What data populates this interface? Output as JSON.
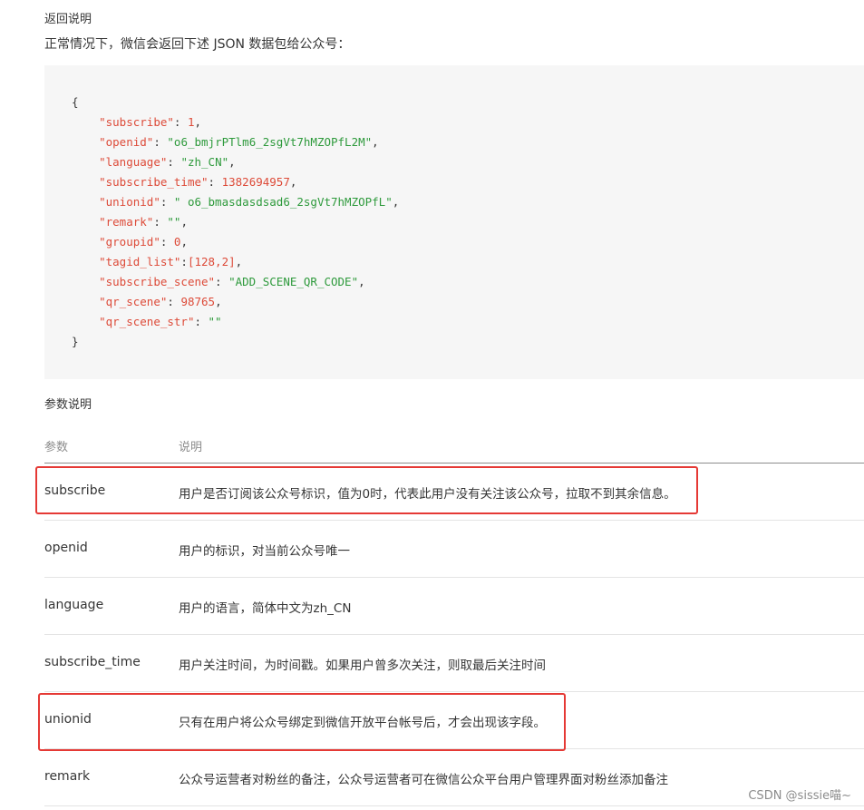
{
  "return_title": "返回说明",
  "intro": "正常情况下，微信会返回下述 JSON 数据包给公众号：",
  "code": [
    {
      "text": "{",
      "type": "brace"
    },
    {
      "key": "\"subscribe\"",
      "val": "1",
      "vtype": "n",
      "comma": ","
    },
    {
      "key": "\"openid\"",
      "val": "\"o6_bmjrPTlm6_2sgVt7hMZOPfL2M\"",
      "vtype": "s",
      "comma": ","
    },
    {
      "key": "\"language\"",
      "val": "\"zh_CN\"",
      "vtype": "s",
      "comma": ","
    },
    {
      "key": "\"subscribe_time\"",
      "val": "1382694957",
      "vtype": "n",
      "comma": ","
    },
    {
      "key": "\"unionid\"",
      "val": "\" o6_bmasdasdsad6_2sgVt7hMZOPfL\"",
      "vtype": "s",
      "comma": ","
    },
    {
      "key": "\"remark\"",
      "val": "\"\"",
      "vtype": "s",
      "comma": ","
    },
    {
      "key": "\"groupid\"",
      "val": "0",
      "vtype": "n",
      "comma": ","
    },
    {
      "key": "\"tagid_list\"",
      "val": "[128,2]",
      "vtype": "n",
      "comma": ",",
      "nospace": true
    },
    {
      "key": "\"subscribe_scene\"",
      "val": "\"ADD_SCENE_QR_CODE\"",
      "vtype": "s",
      "comma": ","
    },
    {
      "key": "\"qr_scene\"",
      "val": "98765",
      "vtype": "n",
      "comma": ","
    },
    {
      "key": "\"qr_scene_str\"",
      "val": "\"\"",
      "vtype": "s",
      "comma": ""
    },
    {
      "text": "}",
      "type": "brace"
    }
  ],
  "params_title": "参数说明",
  "table": {
    "headers": [
      "参数",
      "说明"
    ],
    "rows": [
      {
        "param": "subscribe",
        "desc": "用户是否订阅该公众号标识，值为0时，代表此用户没有关注该公众号，拉取不到其余信息。",
        "highlight": true
      },
      {
        "param": "openid",
        "desc": "用户的标识，对当前公众号唯一",
        "highlight": false
      },
      {
        "param": "language",
        "desc": "用户的语言，简体中文为zh_CN",
        "highlight": false
      },
      {
        "param": "subscribe_time",
        "desc": "用户关注时间，为时间戳。如果用户曾多次关注，则取最后关注时间",
        "highlight": false
      },
      {
        "param": "unionid",
        "desc": "只有在用户将公众号绑定到微信开放平台帐号后，才会出现该字段。",
        "highlight": true
      },
      {
        "param": "remark",
        "desc": "公众号运营者对粉丝的备注，公众号运营者可在微信公众平台用户管理界面对粉丝添加备注",
        "highlight": false
      }
    ]
  },
  "highlight_color": "#e53935",
  "watermark": "CSDN @sissie喵~"
}
